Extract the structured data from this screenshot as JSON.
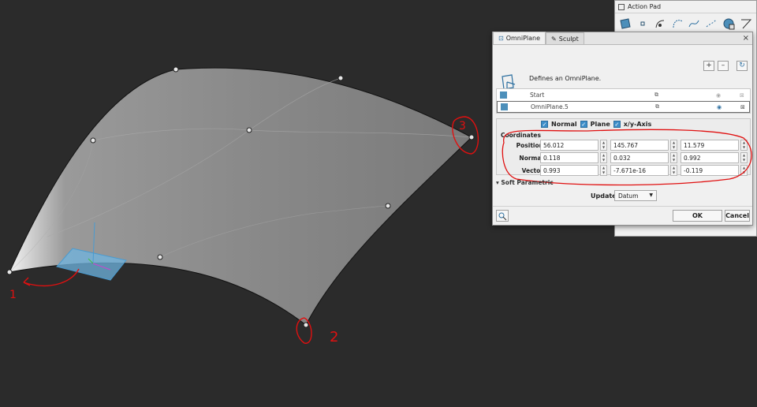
{
  "action_pad": {
    "title": "Action Pad"
  },
  "dialog": {
    "tabs": [
      {
        "label": "OmniPlane",
        "icon": "omniplane-icon"
      },
      {
        "label": "Sculpt",
        "icon": "pencil-icon"
      }
    ],
    "close_symbol": "×",
    "add_symbol": "+",
    "remove_symbol": "–",
    "reset_symbol": "↻",
    "description": "Defines an OmniPlane.",
    "list": [
      {
        "name": "Start",
        "color": "#4c8fba"
      },
      {
        "name": "OmniPlane.5",
        "color": "#4c8fba",
        "selected": true
      }
    ],
    "checks": [
      {
        "label": "Normal",
        "checked": true
      },
      {
        "label": "Plane",
        "checked": true
      },
      {
        "label": "x/y-Axis",
        "checked": true
      }
    ],
    "coordinates": {
      "title": "Coordinates",
      "rows": [
        {
          "label": "Position",
          "values": [
            "56.012",
            "145.767",
            "11.579"
          ]
        },
        {
          "label": "Normal",
          "values": [
            "0.118",
            "0.032",
            "0.992"
          ]
        },
        {
          "label": "Vector",
          "values": [
            "0.993",
            "-7.671e-16",
            "-0.119"
          ]
        }
      ]
    },
    "soft_parametric": "Soft Parametric",
    "update_label": "Update",
    "update_value": "Datum",
    "ok_label": "OK",
    "cancel_label": "Cancel"
  },
  "annotations": {
    "numbers": [
      "1",
      "2",
      "3"
    ],
    "color": "#e01010"
  }
}
